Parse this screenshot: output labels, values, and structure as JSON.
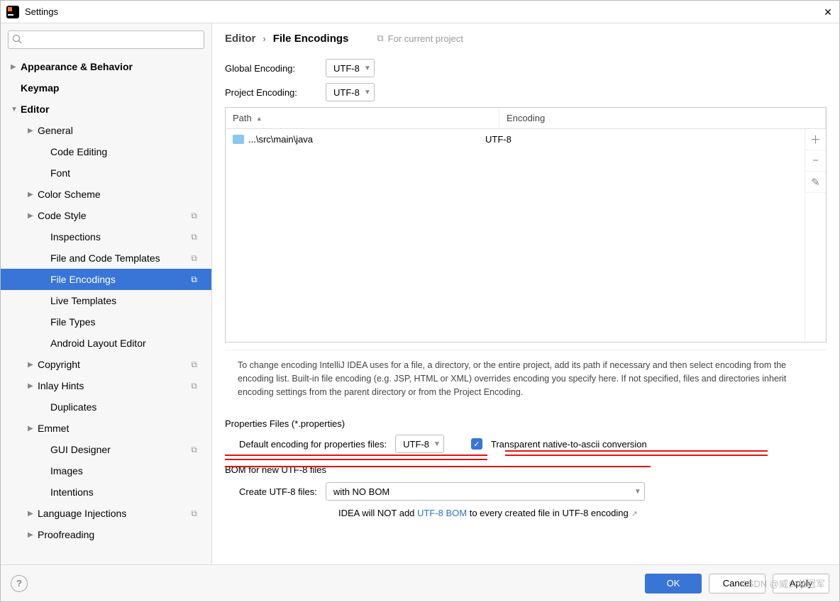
{
  "window": {
    "title": "Settings"
  },
  "search": {
    "placeholder": ""
  },
  "sidebar": {
    "items": [
      {
        "label": "Appearance & Behavior",
        "bold": true,
        "arrow": "right",
        "depth": 0
      },
      {
        "label": "Keymap",
        "bold": true,
        "arrow": "none",
        "depth": 0
      },
      {
        "label": "Editor",
        "bold": true,
        "arrow": "down",
        "depth": 0
      },
      {
        "label": "General",
        "arrow": "right",
        "depth": 1
      },
      {
        "label": "Code Editing",
        "arrow": "none",
        "depth": 2
      },
      {
        "label": "Font",
        "arrow": "none",
        "depth": 2
      },
      {
        "label": "Color Scheme",
        "arrow": "right",
        "depth": 1
      },
      {
        "label": "Code Style",
        "arrow": "right",
        "depth": 1,
        "proj": true
      },
      {
        "label": "Inspections",
        "arrow": "none",
        "depth": 2,
        "proj": true
      },
      {
        "label": "File and Code Templates",
        "arrow": "none",
        "depth": 2,
        "proj": true
      },
      {
        "label": "File Encodings",
        "arrow": "none",
        "depth": 2,
        "proj": true,
        "selected": true
      },
      {
        "label": "Live Templates",
        "arrow": "none",
        "depth": 2
      },
      {
        "label": "File Types",
        "arrow": "none",
        "depth": 2
      },
      {
        "label": "Android Layout Editor",
        "arrow": "none",
        "depth": 2
      },
      {
        "label": "Copyright",
        "arrow": "right",
        "depth": 1,
        "proj": true
      },
      {
        "label": "Inlay Hints",
        "arrow": "right",
        "depth": 1,
        "proj": true
      },
      {
        "label": "Duplicates",
        "arrow": "none",
        "depth": 2
      },
      {
        "label": "Emmet",
        "arrow": "right",
        "depth": 1
      },
      {
        "label": "GUI Designer",
        "arrow": "none",
        "depth": 2,
        "proj": true
      },
      {
        "label": "Images",
        "arrow": "none",
        "depth": 2
      },
      {
        "label": "Intentions",
        "arrow": "none",
        "depth": 2
      },
      {
        "label": "Language Injections",
        "arrow": "right",
        "depth": 1,
        "proj": true
      },
      {
        "label": "Proofreading",
        "arrow": "right",
        "depth": 1
      }
    ]
  },
  "breadcrumb": {
    "part1": "Editor",
    "part2": "File Encodings",
    "scope": "For current project"
  },
  "encodings": {
    "global_label": "Global Encoding:",
    "global_value": "UTF-8",
    "project_label": "Project Encoding:",
    "project_value": "UTF-8"
  },
  "table": {
    "col_path": "Path",
    "col_encoding": "Encoding",
    "rows": [
      {
        "path": "...\\src\\main\\java",
        "encoding": "UTF-8"
      }
    ]
  },
  "hint": "To change encoding IntelliJ IDEA uses for a file, a directory, or the entire project, add its path if necessary and then select encoding from the encoding list. Built-in file encoding (e.g. JSP, HTML or XML) overrides encoding you specify here. If not specified, files and directories inherit encoding settings from the parent directory or from the Project Encoding.",
  "properties": {
    "section_title": "Properties Files (*.properties)",
    "default_label": "Default encoding for properties files:",
    "default_value": "UTF-8",
    "checkbox_label": "Transparent native-to-ascii conversion",
    "checkbox_checked": true
  },
  "bom": {
    "section_title": "BOM for new UTF-8 files",
    "create_label": "Create UTF-8 files:",
    "create_value": "with NO BOM",
    "hint_pre": "IDEA will NOT add ",
    "hint_link": "UTF-8 BOM",
    "hint_post": " to every created file in UTF-8 encoding"
  },
  "footer": {
    "ok": "OK",
    "cancel": "Cancel",
    "apply": "Apply",
    "watermark": "CSDN @威少总冠军"
  }
}
